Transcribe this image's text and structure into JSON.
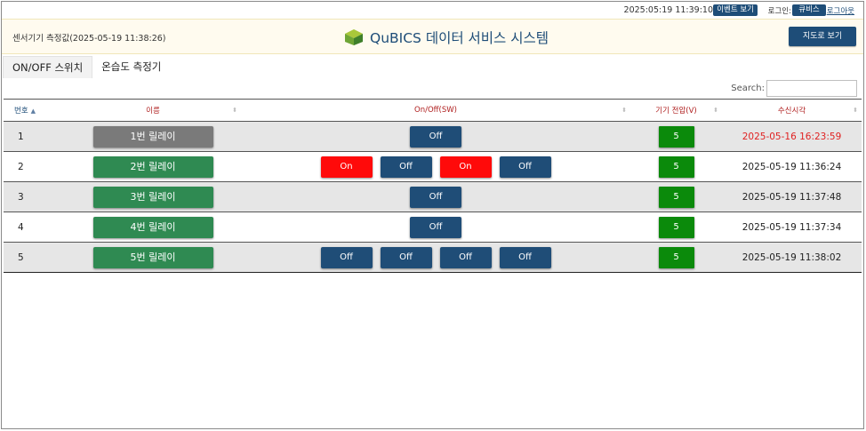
{
  "topbar": {
    "clock": "2025:05:19 11:39:10",
    "event_button": "이벤트 보기",
    "login_label": "로그인:",
    "user_button": "큐비스",
    "logout_link": "로그아웃"
  },
  "header": {
    "measure_time": "센서기기 측정값(2025-05-19 11:38:26)",
    "title": "QuBICS 데이터 서비스 시스템",
    "map_button": "지도로 보기"
  },
  "tabs": [
    {
      "label": "ON/OFF 스위치",
      "active": true
    },
    {
      "label": "온습도 측정기",
      "active": false
    }
  ],
  "search": {
    "label": "Search:",
    "value": ""
  },
  "table": {
    "columns": [
      "번호",
      "이름",
      "On/Off(SW)",
      "기기 전압(V)",
      "수신시각"
    ],
    "rows": [
      {
        "no": "1",
        "name": "1번 릴레이",
        "name_style": "gray",
        "switches": [
          "Off"
        ],
        "voltage": "5",
        "time": "2025-05-16 16:23:59",
        "time_alert": true
      },
      {
        "no": "2",
        "name": "2번 릴레이",
        "name_style": "green",
        "switches": [
          "On",
          "Off",
          "On",
          "Off"
        ],
        "voltage": "5",
        "time": "2025-05-19 11:36:24",
        "time_alert": false
      },
      {
        "no": "3",
        "name": "3번 릴레이",
        "name_style": "green",
        "switches": [
          "Off"
        ],
        "voltage": "5",
        "time": "2025-05-19 11:37:48",
        "time_alert": false
      },
      {
        "no": "4",
        "name": "4번 릴레이",
        "name_style": "green",
        "switches": [
          "Off"
        ],
        "voltage": "5",
        "time": "2025-05-19 11:37:34",
        "time_alert": false
      },
      {
        "no": "5",
        "name": "5번 릴레이",
        "name_style": "green",
        "switches": [
          "Off",
          "Off",
          "Off",
          "Off"
        ],
        "voltage": "5",
        "time": "2025-05-19 11:38:02",
        "time_alert": false
      }
    ]
  },
  "colors": {
    "brand_navy": "#1e4d78",
    "on_red": "#ff0a0a",
    "voltage_green": "#0b8a0b",
    "relay_green": "#2f8a52",
    "relay_gray": "#7a7a7a",
    "alert_red": "#e02222"
  },
  "icons": {
    "logo": "cube-leaf-logo-icon",
    "sort": "sort-arrows-icon"
  }
}
